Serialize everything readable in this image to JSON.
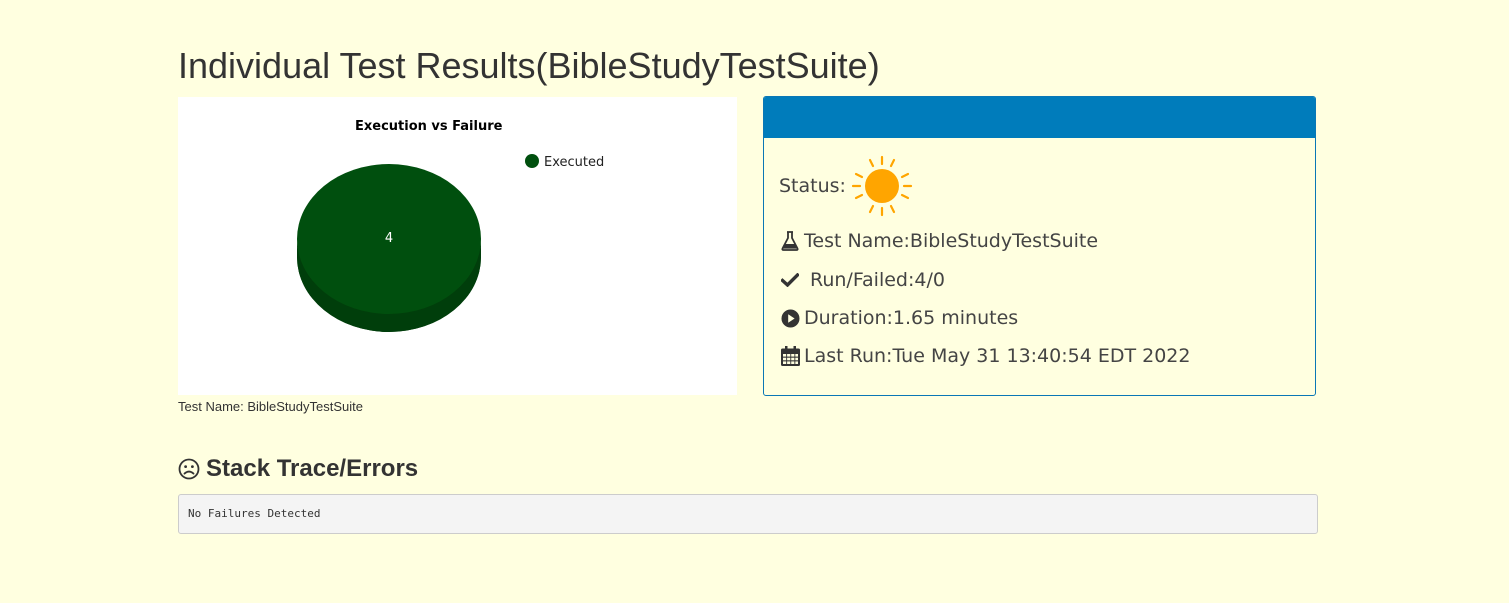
{
  "page": {
    "title": "Individual Test Results(BibleStudyTestSuite)"
  },
  "chart": {
    "caption": "Test Name: BibleStudyTestSuite"
  },
  "chart_data": {
    "type": "pie",
    "title": "Execution vs Failure",
    "categories": [
      "Executed"
    ],
    "values": [
      4
    ],
    "colors": [
      "#004f0e"
    ],
    "legend_position": "top-right",
    "data_labels": [
      "4"
    ]
  },
  "status_card": {
    "header_color": "#007cbb",
    "status_label": "Status:",
    "status_icon": "sun-icon",
    "test_name": "Test Name:BibleStudyTestSuite",
    "run_failed": "Run/Failed:4/0",
    "duration": "Duration:1.65 minutes",
    "last_run": "Last Run:Tue May 31 13:40:54 EDT 2022"
  },
  "stack_trace": {
    "title": "Stack Trace/Errors",
    "content": "No Failures Detected"
  }
}
